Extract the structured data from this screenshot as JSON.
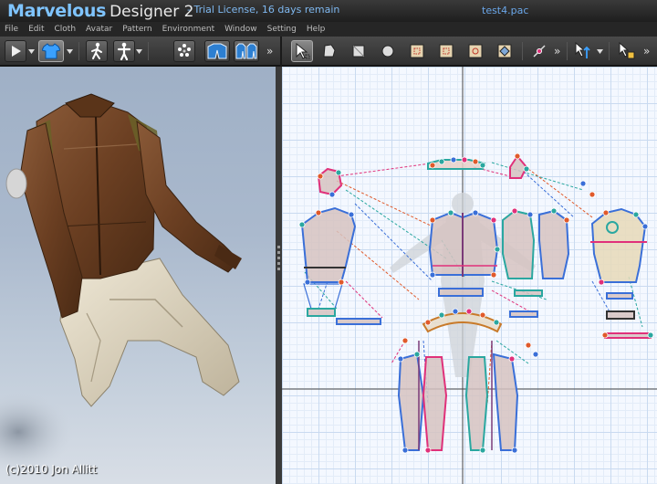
{
  "app": {
    "brand_main": "Marvelous",
    "brand_sub": "Designer 2",
    "license": "-  Trial License, 16 days remain",
    "filename": "test4.pac"
  },
  "menu": [
    "File",
    "Edit",
    "Cloth",
    "Avatar",
    "Pattern",
    "Environment",
    "Window",
    "Setting",
    "Help"
  ],
  "toolbar_left": {
    "overflow": "»",
    "buttons": [
      "play-icon",
      "shirt-icon",
      "walk-icon",
      "avatar-icon",
      "points-icon",
      "garment-icon",
      "garment-pair-icon"
    ]
  },
  "toolbar_right": {
    "overflow": "»",
    "buttons": [
      "select-arrow-icon",
      "polygon-icon",
      "rectangle-icon",
      "circle-icon",
      "internal-rect-icon",
      "internal-polygon-icon",
      "notch-icon",
      "diamond-icon",
      "edit-point-icon",
      "transform-icon",
      "sewing-select-icon"
    ]
  },
  "viewport": {
    "copyright": "(c)2010 Jon Allitt"
  }
}
